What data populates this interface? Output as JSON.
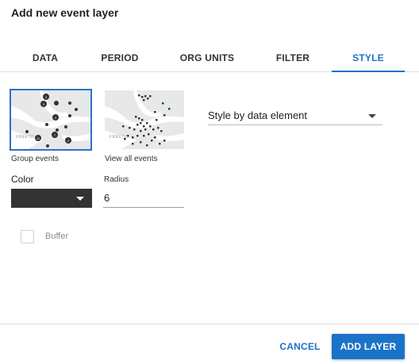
{
  "dialog": {
    "title": "Add new event layer"
  },
  "tabs": [
    {
      "label": "DATA",
      "active": false
    },
    {
      "label": "PERIOD",
      "active": false
    },
    {
      "label": "ORG UNITS",
      "active": false
    },
    {
      "label": "FILTER",
      "active": false
    },
    {
      "label": "STYLE",
      "active": true
    }
  ],
  "style": {
    "group_events": {
      "label": "Group events",
      "selected": true
    },
    "view_all_events": {
      "label": "View all events",
      "selected": false
    },
    "map_place_label": "FREETO",
    "color": {
      "label": "Color",
      "value": "#333333"
    },
    "radius": {
      "label": "Radius",
      "value": "6"
    },
    "style_by": {
      "value": "Style by data element"
    },
    "buffer": {
      "label": "Buffer",
      "checked": false
    }
  },
  "footer": {
    "cancel_label": "CANCEL",
    "add_label": "ADD LAYER"
  },
  "colors": {
    "accent": "#1a73c8",
    "event_marker": "#333333",
    "map_land": "#e6e8e9"
  }
}
